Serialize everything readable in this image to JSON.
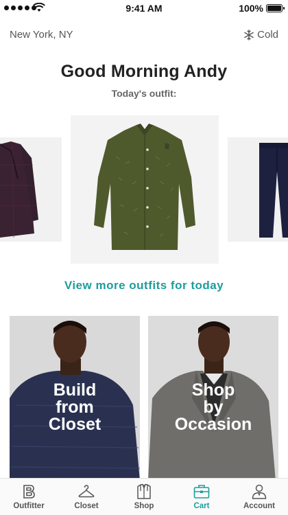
{
  "status_bar": {
    "time": "9:41 AM",
    "battery": "100%"
  },
  "header": {
    "location": "New York, NY",
    "weather": "Cold",
    "weather_icon": "snowflake-icon"
  },
  "greeting": "Good Morning Andy",
  "subtitle": "Today's outfit:",
  "outfit_carousel": {
    "items": [
      {
        "name": "coat",
        "color": "#3a2233"
      },
      {
        "name": "shirt",
        "color": "#4f5a2c"
      },
      {
        "name": "pants",
        "color": "#1e2040"
      }
    ]
  },
  "more_outfits_link": "View more outfits for today",
  "tiles": {
    "left": {
      "line1": "Build",
      "line2": "from",
      "line3": "Closet"
    },
    "right": {
      "line1": "Shop",
      "line2": "by",
      "line3": "Occasion"
    }
  },
  "tab_bar": {
    "active_tab": "Cart",
    "accent_color": "#1c9c9c",
    "tabs": [
      {
        "label": "Outfitter",
        "icon": "outfitter-logo-icon"
      },
      {
        "label": "Closet",
        "icon": "hanger-icon"
      },
      {
        "label": "Shop",
        "icon": "shirt-icon"
      },
      {
        "label": "Cart",
        "icon": "briefcase-icon"
      },
      {
        "label": "Account",
        "icon": "person-icon"
      }
    ]
  }
}
